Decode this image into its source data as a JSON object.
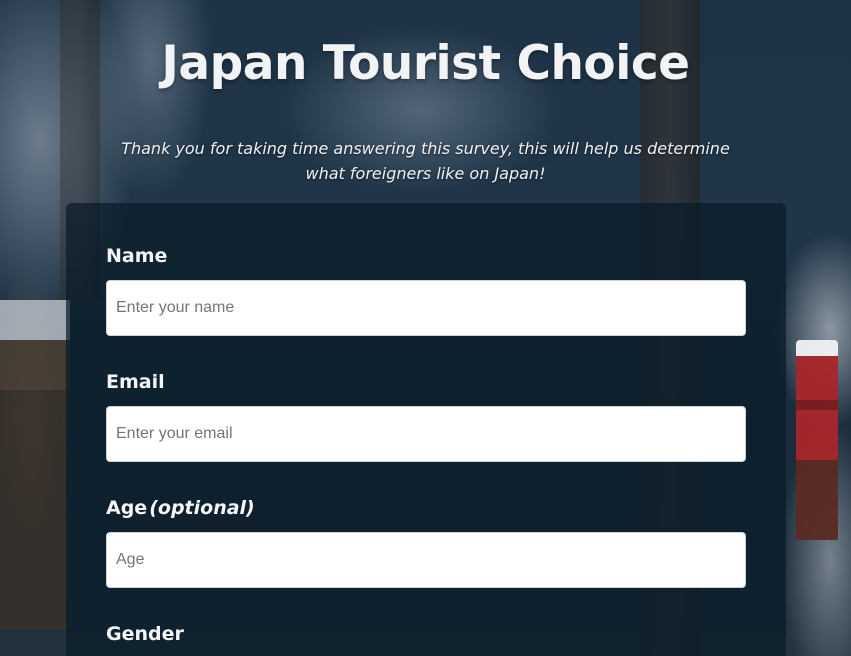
{
  "header": {
    "title": "Japan Tourist Choice",
    "description": "Thank you for taking time answering this survey, this will help us determine what foreigners like on Japan!"
  },
  "form": {
    "name": {
      "label": "Name",
      "placeholder": "Enter your name",
      "value": ""
    },
    "email": {
      "label": "Email",
      "placeholder": "Enter your email",
      "value": ""
    },
    "age": {
      "label": "Age",
      "optional_note": "(optional)",
      "placeholder": "Age",
      "value": ""
    },
    "gender": {
      "label": "Gender"
    }
  },
  "colors": {
    "form_background": "#081c28",
    "text": "#f4f5f7",
    "input_background": "#ffffff"
  }
}
